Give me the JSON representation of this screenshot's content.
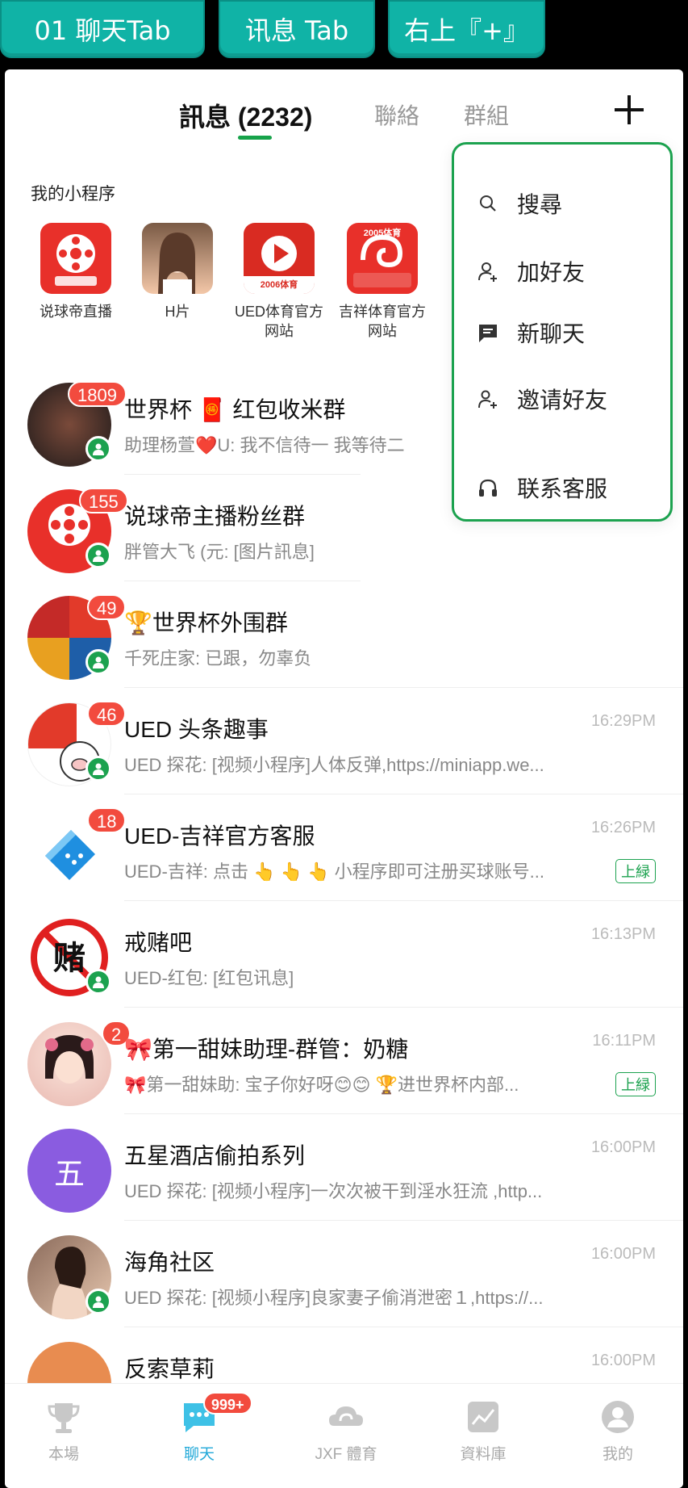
{
  "annotations": [
    "01 聊天Tab",
    "讯息 Tab",
    "右上『+』"
  ],
  "header": {
    "tabs": [
      {
        "label": "訊息 (2232)",
        "active": true
      },
      {
        "label": "聯絡",
        "active": false
      },
      {
        "label": "群組",
        "active": false
      }
    ]
  },
  "mini_programs": {
    "title": "我的小程序",
    "apps": [
      {
        "label": "说球帝直播",
        "icon": "film-reel-icon",
        "color": "#e8302a"
      },
      {
        "label": "H片",
        "icon": "girl-photo-icon",
        "color": "#f3c7a8"
      },
      {
        "label": "UED体育官方网站",
        "icon": "play-icon",
        "badge_text": "2006体育",
        "color": "#d92b22"
      },
      {
        "label": "吉祥体育官方网站",
        "icon": "swirl-icon",
        "badge_text": "2005体育",
        "color": "#e8302a"
      }
    ]
  },
  "popup_menu": {
    "items": [
      {
        "label": "搜尋",
        "icon": "search-icon"
      },
      {
        "label": "加好友",
        "icon": "add-friend-icon"
      },
      {
        "label": "新聊天",
        "icon": "chat-icon"
      },
      {
        "label": "邀请好友",
        "icon": "invite-friend-icon"
      },
      {
        "label": "联系客服",
        "icon": "headset-icon"
      }
    ]
  },
  "chats": [
    {
      "title": "世界杯 🧧 红包收米群",
      "subtitle": "助理杨萱❤️U: 我不信待一 我等待二",
      "count": "1809",
      "time": "",
      "tag": "",
      "avatar_color": "#3a2b2b"
    },
    {
      "title": "说球帝主播粉丝群",
      "subtitle": "胖管大飞 (元: [图片訊息]",
      "count": "155",
      "time": "",
      "tag": "",
      "avatar_color": "#e8302a"
    },
    {
      "title": "🏆世界杯外围群",
      "subtitle": "千死庄家: 已跟，勿辜负",
      "count": "49",
      "time": "",
      "tag": "",
      "avatar_color": "#e25a2c"
    },
    {
      "title": "UED 头条趣事",
      "subtitle": "UED 探花: [视频小程序]人体反弹,https://miniapp.we...",
      "count": "46",
      "time": "16:29PM",
      "tag": "",
      "avatar_color": "#ffffff"
    },
    {
      "title": "UED-吉祥官方客服",
      "subtitle": "UED-吉祥: 点击 👆 👆 👆 小程序即可注册买球账号...",
      "count": "18",
      "time": "16:26PM",
      "tag": "上緑",
      "avatar_color": "#ffffff"
    },
    {
      "title": "戒赌吧",
      "subtitle": "UED-红包: [红包讯息]",
      "count": "",
      "time": "16:13PM",
      "tag": "",
      "avatar_color": "#ffffff"
    },
    {
      "title": "🎀第一甜妹助理-群管：奶糖",
      "subtitle": "🎀第一甜妹助: 宝子你好呀😊😊 🏆进世界杯内部...",
      "count": "2",
      "time": "16:11PM",
      "tag": "上緑",
      "avatar_color": "#f7d9d9"
    },
    {
      "title": "五星酒店偷拍系列",
      "subtitle": "UED 探花: [视频小程序]一次次被干到淫水狂流 ,http...",
      "count": "",
      "time": "16:00PM",
      "tag": "",
      "avatar_color": "#8a5ce0",
      "avatar_text": "五"
    },
    {
      "title": "海角社区",
      "subtitle": "UED 探花: [视频小程序]良家妻子偷消泄密１,https://...",
      "count": "",
      "time": "16:00PM",
      "tag": "",
      "avatar_color": "#d9b9a5"
    },
    {
      "title": "反索草莉",
      "subtitle": "",
      "count": "",
      "time": "16:00PM",
      "tag": "",
      "avatar_color": "#e88c50"
    }
  ],
  "bottom_nav": [
    {
      "label": "本場",
      "icon": "trophy-icon"
    },
    {
      "label": "聊天",
      "icon": "chat-bubble-icon",
      "badge": "999+",
      "active": true
    },
    {
      "label": "JXF 體育",
      "icon": "cloud-logo-icon"
    },
    {
      "label": "資料庫",
      "icon": "chart-icon"
    },
    {
      "label": "我的",
      "icon": "profile-icon"
    }
  ]
}
